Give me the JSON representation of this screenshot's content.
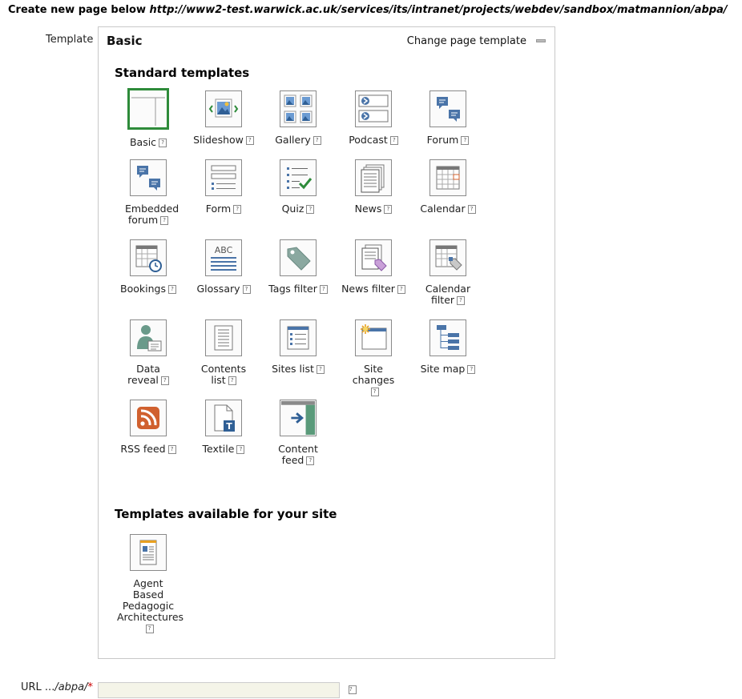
{
  "heading": {
    "prefix": "Create new page below",
    "url": "http://www2-test.warwick.ac.uk/services/its/intranet/projects/webdev/sandbox/matmannion/abpa/"
  },
  "template_label": "Template",
  "panel": {
    "current_template": "Basic",
    "change_link": "Change page template"
  },
  "standard_section_title": "Standard templates",
  "site_section_title": "Templates available for your site",
  "standard_templates": [
    {
      "label": "Basic",
      "icon": "basic-layout-icon",
      "selected": true
    },
    {
      "label": "Slideshow",
      "icon": "slideshow-icon"
    },
    {
      "label": "Gallery",
      "icon": "gallery-icon"
    },
    {
      "label": "Podcast",
      "icon": "podcast-icon"
    },
    {
      "label": "Forum",
      "icon": "forum-icon"
    },
    {
      "label": "Embedded forum",
      "icon": "embedded-forum-icon"
    },
    {
      "label": "Form",
      "icon": "form-icon"
    },
    {
      "label": "Quiz",
      "icon": "quiz-icon"
    },
    {
      "label": "News",
      "icon": "news-icon"
    },
    {
      "label": "Calendar",
      "icon": "calendar-icon"
    },
    {
      "label": "Bookings",
      "icon": "bookings-icon"
    },
    {
      "label": "Glossary",
      "icon": "glossary-icon"
    },
    {
      "label": "Tags filter",
      "icon": "tags-filter-icon"
    },
    {
      "label": "News filter",
      "icon": "news-filter-icon"
    },
    {
      "label": "Calendar filter",
      "icon": "calendar-filter-icon"
    },
    {
      "label": "Data reveal",
      "icon": "data-reveal-icon"
    },
    {
      "label": "Contents list",
      "icon": "contents-list-icon"
    },
    {
      "label": "Sites list",
      "icon": "sites-list-icon"
    },
    {
      "label": "Site changes",
      "icon": "site-changes-icon"
    },
    {
      "label": "Site map",
      "icon": "site-map-icon"
    },
    {
      "label": "RSS feed",
      "icon": "rss-feed-icon"
    },
    {
      "label": "Textile",
      "icon": "textile-icon"
    },
    {
      "label": "Content feed",
      "icon": "content-feed-icon"
    }
  ],
  "site_templates": [
    {
      "label": "Agent Based Pedagogic Architectures",
      "icon": "site-template-icon"
    }
  ],
  "help_glyph": "?",
  "url_field": {
    "label_prefix": "URL ...",
    "label_path": "/abpa/",
    "required_mark": "*",
    "value": ""
  },
  "colors": {
    "selected_border": "#2e8b3a",
    "icon_blue": "#4a74a8",
    "rss_orange": "#d0602e",
    "required_red": "#cc0000"
  }
}
